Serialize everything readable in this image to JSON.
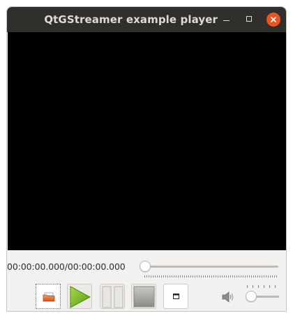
{
  "window": {
    "title": "QtGStreamer example player"
  },
  "titlebar_buttons": {
    "minimize_icon": "minimize-icon",
    "maximize_icon": "maximize-icon",
    "close_icon": "close-icon",
    "close_color": "#e95420"
  },
  "video": {
    "background": "#000000"
  },
  "playback": {
    "time_text": "00:00:00.000/00:00:00.000",
    "position_fraction": 0
  },
  "controls": {
    "open_icon": "folder-open-icon",
    "play_icon": "play-icon",
    "pause_icon": "pause-icon",
    "stop_icon": "stop-icon",
    "fullscreen_icon": "fullscreen-icon",
    "play_color": "#7fbf24"
  },
  "volume": {
    "icon": "speaker-icon",
    "level_fraction": 0
  }
}
